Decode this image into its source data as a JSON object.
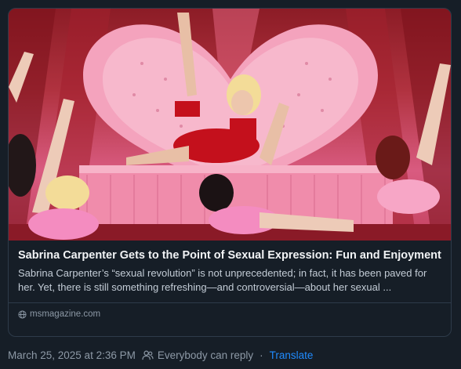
{
  "post": {
    "link_card": {
      "title": "Sabrina Carpenter Gets to the Point of Sexual Expression: Fun and Enjoyment",
      "description": "Sabrina Carpenter’s “sexual revolution” is not unprecedented; in fact, it has been paved for her. Yet, there is still something refreshing—and controversial—about her sexual ...",
      "source": "msmagazine.com",
      "image_icon": "globe-icon"
    },
    "meta": {
      "timestamp": "March 25, 2025 at 2:36 PM",
      "reply_setting": "Everybody can reply",
      "separator": "·",
      "translate_label": "Translate"
    }
  },
  "colors": {
    "background": "#161e27",
    "title": "#f1f3f5",
    "text_muted": "#8d99a6",
    "link": "#208bfe"
  }
}
